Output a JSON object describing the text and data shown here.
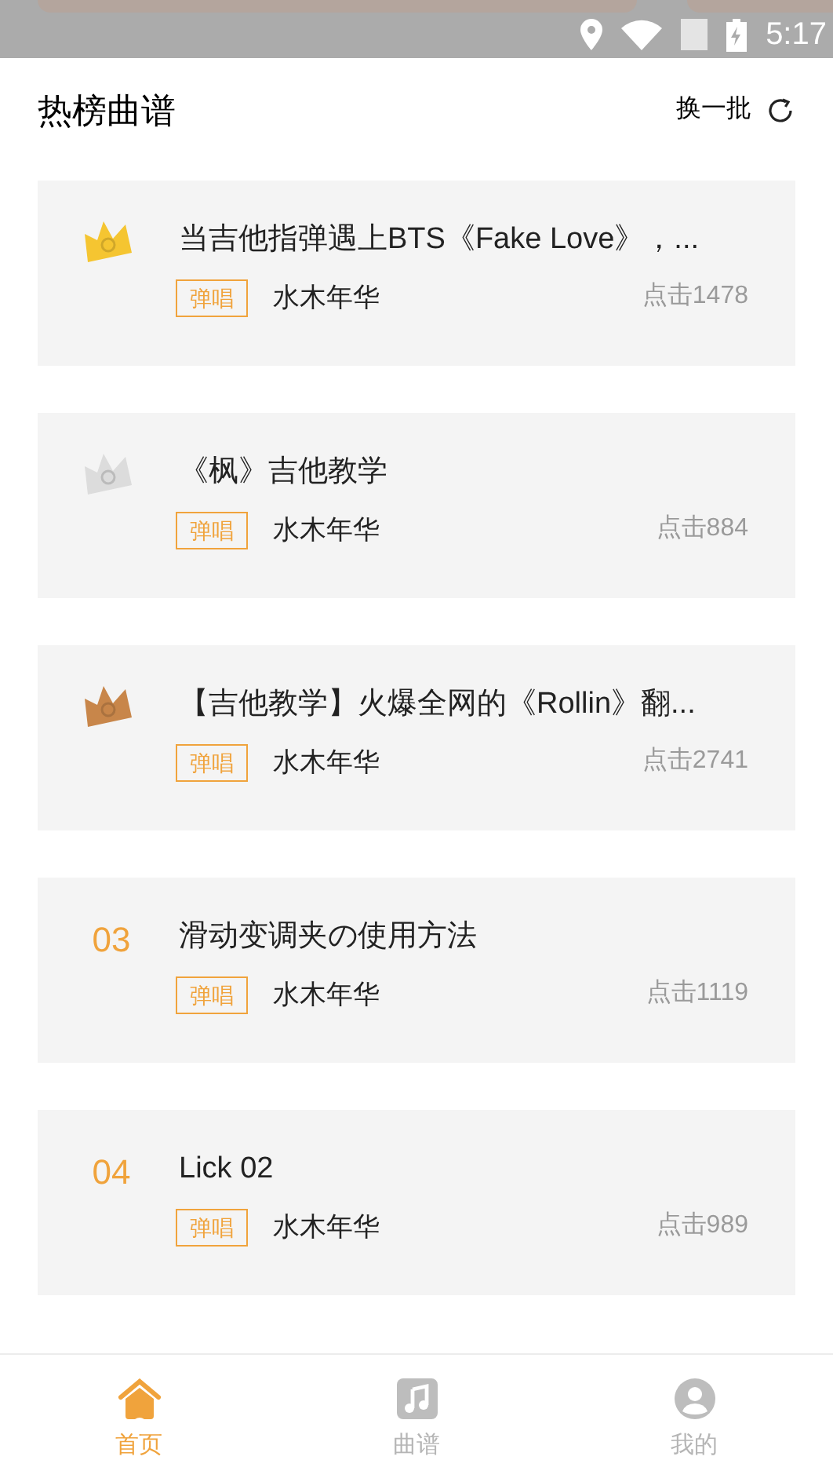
{
  "status_bar": {
    "time": "5:17"
  },
  "header": {
    "title": "热榜曲谱",
    "refresh": "换一批"
  },
  "items": [
    {
      "rank": {
        "kind": "crown",
        "color": "#f5c531"
      },
      "title": "当吉他指弹遇上BTS《Fake Love》，...",
      "tag": "弹唱",
      "author": "水木年华",
      "clicks": "点击1478"
    },
    {
      "rank": {
        "kind": "crown",
        "color": "#dcdcdc"
      },
      "title": "《枫》吉他教学",
      "tag": "弹唱",
      "author": "水木年华",
      "clicks": "点击884"
    },
    {
      "rank": {
        "kind": "crown",
        "color": "#c8864a"
      },
      "title": "【吉他教学】火爆全网的《Rollin》翻...",
      "tag": "弹唱",
      "author": "水木年华",
      "clicks": "点击2741"
    },
    {
      "rank": {
        "kind": "number",
        "text": "03"
      },
      "title": "滑动变调夹の使用方法",
      "tag": "弹唱",
      "author": "水木年华",
      "clicks": "点击1119"
    },
    {
      "rank": {
        "kind": "number",
        "text": "04"
      },
      "title": "Lick 02",
      "tag": "弹唱",
      "author": "水木年华",
      "clicks": "点击989"
    }
  ],
  "tab_bar": [
    {
      "label": "首页",
      "kind": "home",
      "selected": true
    },
    {
      "label": "曲谱",
      "kind": "music",
      "selected": false
    },
    {
      "label": "我的",
      "kind": "profile",
      "selected": false
    }
  ]
}
